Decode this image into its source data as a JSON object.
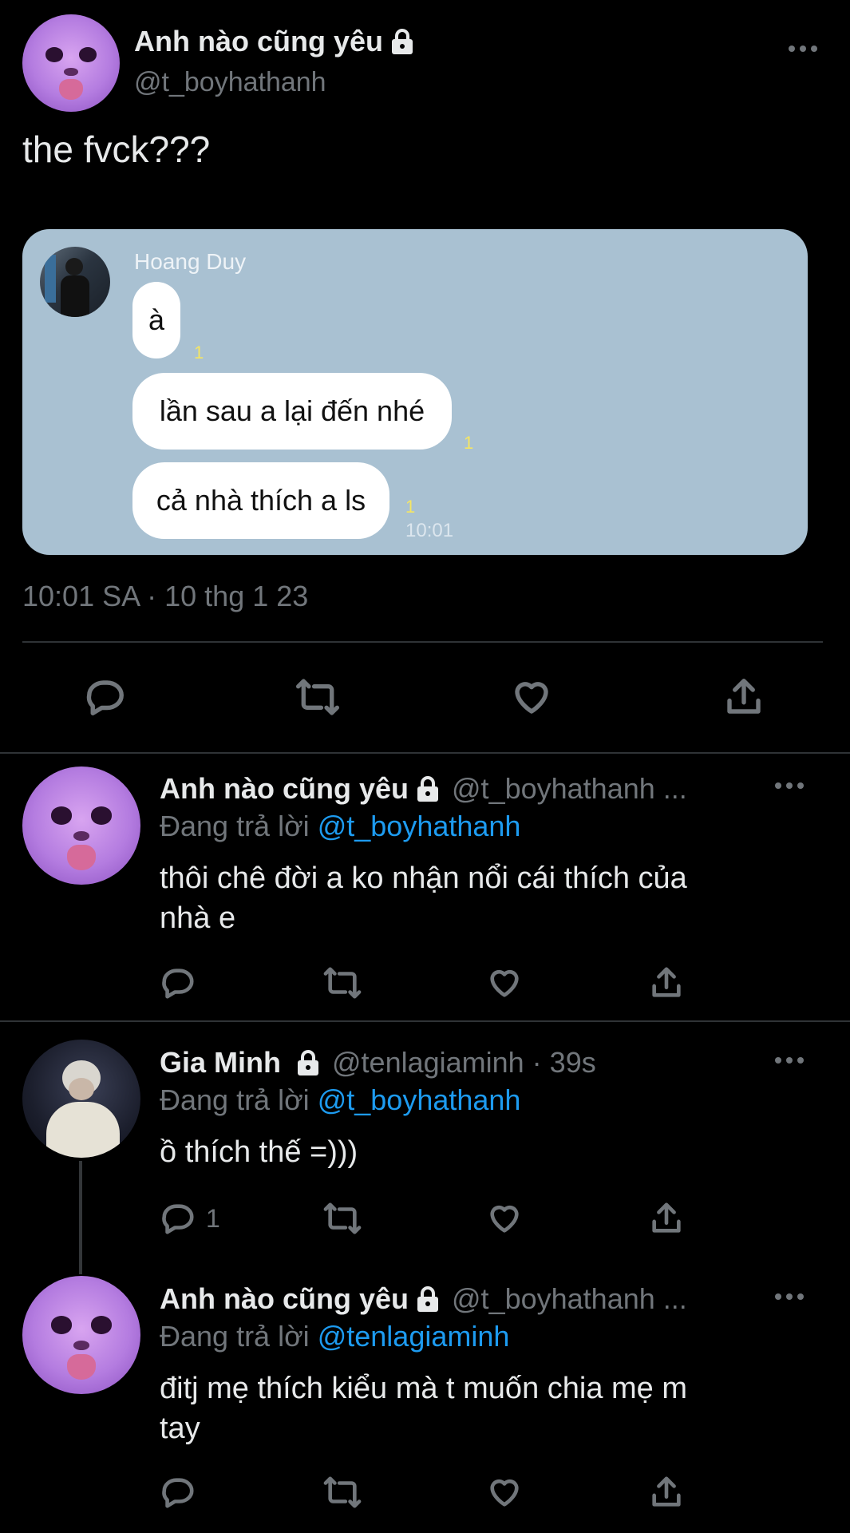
{
  "main_tweet": {
    "author_name": "Anh nào cũng yêu",
    "handle": "@t_boyhathanh",
    "text": "the fvck???",
    "timestamp": "10:01 SA · 10 thg 1 23",
    "embedded_chat": {
      "sender": "Hoang Duy",
      "messages": [
        {
          "text": "à",
          "read": "1"
        },
        {
          "text": "lần sau a lại đến nhé",
          "read": "1"
        },
        {
          "text": "cả nhà thích a ls",
          "read": "1",
          "time": "10:01"
        }
      ]
    }
  },
  "replies": [
    {
      "author_name": "Anh nào cũng yêu",
      "meta": "@t_boyhathanh ...",
      "replying_prefix": "Đang trả lời",
      "replying_to": "@t_boyhathanh",
      "text_line1": "thôi chê đời a ko nhận nổi cái thích của",
      "text_line2": "nhà e",
      "reply_count": ""
    },
    {
      "author_name": "Gia Minh",
      "meta": "@tenlagiaminh · 39s",
      "replying_prefix": "Đang trả lời",
      "replying_to": "@t_boyhathanh",
      "text_line1": "ồ thích thế =)))",
      "text_line2": "",
      "reply_count": "1"
    },
    {
      "author_name": "Anh nào cũng yêu",
      "meta": "@t_boyhathanh ...",
      "replying_prefix": "Đang trả lời",
      "replying_to": "@tenlagiaminh",
      "text_line1": "đitj mẹ thích kiểu mà t muốn chia mẹ m",
      "text_line2": "tay",
      "reply_count": ""
    }
  ],
  "colors": {
    "background": "#000000",
    "text": "#e7e9ea",
    "muted": "#71767b",
    "link": "#1d9bf0",
    "chat_background": "#a9c1d2",
    "read_indicator": "#f5e663"
  },
  "icons": [
    "more-icon",
    "lock-icon",
    "reply-icon",
    "retweet-icon",
    "like-icon",
    "share-icon"
  ]
}
